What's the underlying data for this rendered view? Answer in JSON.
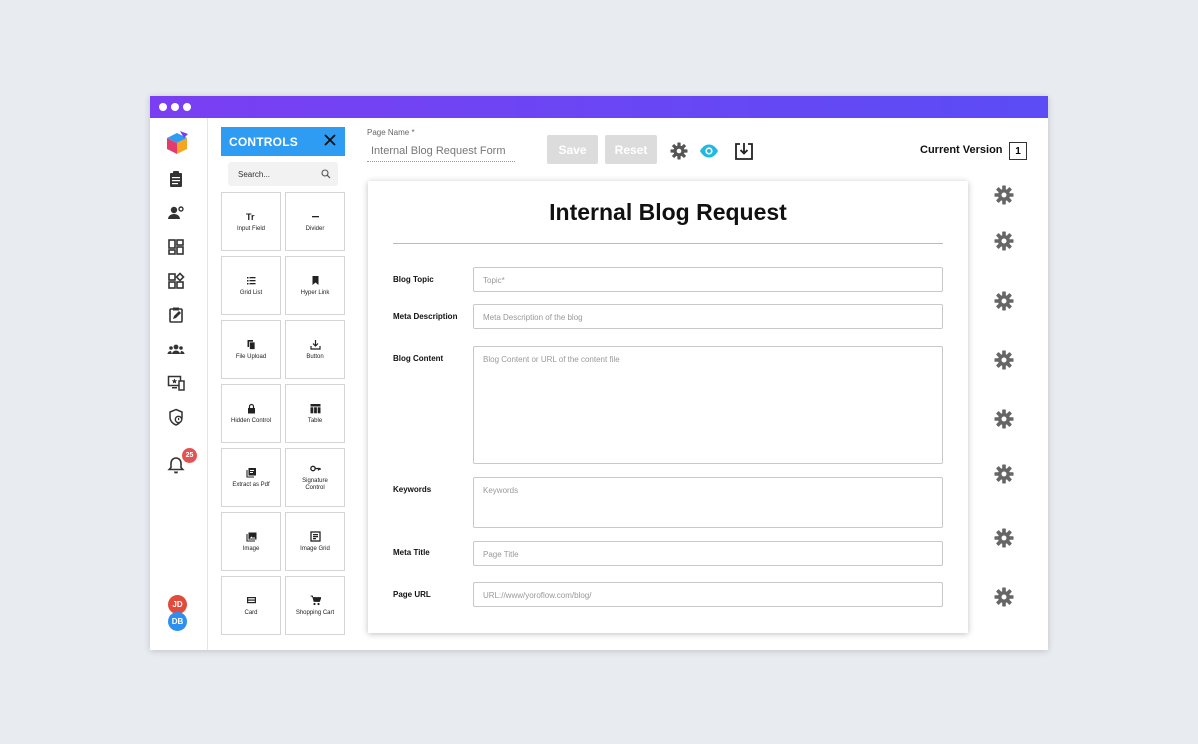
{
  "nav": {
    "notification_count": "25",
    "avatars": [
      {
        "initials": "JD",
        "color": "#e04b3c"
      },
      {
        "initials": "DB",
        "color": "#2d8ff0"
      }
    ]
  },
  "controls": {
    "title": "CONTROLS",
    "search_placeholder": "Search...",
    "items": [
      {
        "label": "Input Field",
        "icon": "text-format-icon"
      },
      {
        "label": "Divider",
        "icon": "divider-icon"
      },
      {
        "label": "Grid List",
        "icon": "list-icon"
      },
      {
        "label": "Hyper Link",
        "icon": "bookmark-icon"
      },
      {
        "label": "File Upload",
        "icon": "file-copy-icon"
      },
      {
        "label": "Button",
        "icon": "download-icon"
      },
      {
        "label": "Hidden Control",
        "icon": "lock-icon"
      },
      {
        "label": "Table",
        "icon": "table-icon"
      },
      {
        "label": "Extract as Pdf",
        "icon": "pdf-icon"
      },
      {
        "label": "Signature Control",
        "icon": "key-icon"
      },
      {
        "label": "Image",
        "icon": "image-icon"
      },
      {
        "label": "Image Grid",
        "icon": "image-grid-icon"
      },
      {
        "label": "Card",
        "icon": "card-icon"
      },
      {
        "label": "Shopping Cart",
        "icon": "cart-icon"
      }
    ]
  },
  "toolbar": {
    "page_name_label": "Page Name *",
    "page_name_value": "Internal Blog Request Form",
    "save_label": "Save",
    "reset_label": "Reset",
    "version_label": "Current Version",
    "version_value": "1"
  },
  "form": {
    "title": "Internal Blog Request",
    "fields": [
      {
        "label": "Blog Topic",
        "placeholder": "Topic*"
      },
      {
        "label": "Meta Description",
        "placeholder": "Meta Description of the blog"
      },
      {
        "label": "Blog Content",
        "placeholder": "Blog Content or URL of the content file"
      },
      {
        "label": "Keywords",
        "placeholder": "Keywords"
      },
      {
        "label": "Meta Title",
        "placeholder": "Page Title"
      },
      {
        "label": "Page URL",
        "placeholder": "URL://www/yoroflow.com/blog/"
      }
    ]
  },
  "colors": {
    "titlebar_start": "#7a3ff2",
    "titlebar_end": "#5b4cf5",
    "controls_header": "#2d9cf2",
    "preview_eye": "#22b8e0",
    "badge": "#e25454"
  }
}
